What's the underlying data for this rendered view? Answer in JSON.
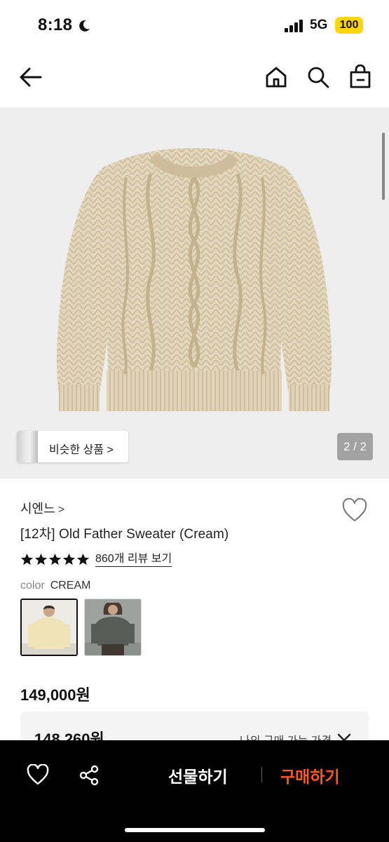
{
  "status_bar": {
    "time": "8:18",
    "network": "5G",
    "battery": "100"
  },
  "header": {
    "icons": [
      "back-arrow-icon",
      "home-icon",
      "search-icon",
      "shopping-bag-icon"
    ]
  },
  "gallery": {
    "similar_label": "비슷한 상품 >",
    "counter": "2 / 2"
  },
  "product": {
    "brand": "시엔느",
    "brand_chevron": ">",
    "title": "[12차] Old Father Sweater (Cream)",
    "rating_stars": 5,
    "review_link": "860개 리뷰 보기",
    "color_key": "color",
    "color_value": "CREAM",
    "price": "149,000원",
    "my_price": "148,260원",
    "my_price_label": "나의 구매 가능 가격"
  },
  "action_bar": {
    "gift_label": "선물하기",
    "buy_label": "구매하기",
    "buy_color": "#ff5b1a"
  }
}
